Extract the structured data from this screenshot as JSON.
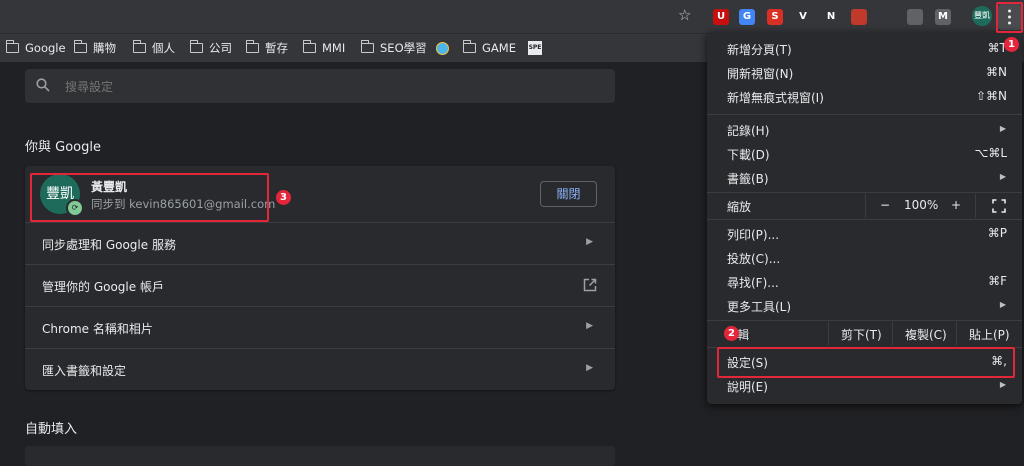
{
  "toolbar": {
    "profile_label": "豐凱",
    "extensions": [
      {
        "name": "ublock",
        "glyph": "U",
        "color": "#c70f0f"
      },
      {
        "name": "translate",
        "glyph": "G",
        "color": "#4285f4"
      },
      {
        "name": "s-ext",
        "glyph": "S",
        "color": "#d93025"
      },
      {
        "name": "vue",
        "glyph": "V",
        "color": "#35363a"
      },
      {
        "name": "notion",
        "glyph": "N",
        "color": "#35363a"
      },
      {
        "name": "book",
        "glyph": "",
        "color": "#c0392b"
      },
      {
        "name": "github",
        "glyph": "",
        "color": "#35363a"
      },
      {
        "name": "stack",
        "glyph": "",
        "color": "#5f6368"
      },
      {
        "name": "m-ext",
        "glyph": "M",
        "color": "#5f6368"
      }
    ]
  },
  "bookmarks": [
    "Google",
    "購物",
    "個人",
    "公司",
    "暫存",
    "MMI",
    "SEO學習",
    "GAME"
  ],
  "bookmark_special": "SPE",
  "search": {
    "placeholder": "搜尋設定"
  },
  "section_you": {
    "title": "你與 Google",
    "avatar_text": "豐凱",
    "user_name": "黃豐凱",
    "user_sync": "同步到 kevin865601@gmail.com",
    "close_button": "關閉",
    "rows": [
      "同步處理和 Google 服務",
      "管理你的 Google 帳戶",
      "Chrome 名稱和相片",
      "匯入書籤和設定"
    ]
  },
  "section_autofill": {
    "title": "自動填入"
  },
  "menu": {
    "new_tab": "新增分頁(T)",
    "new_tab_sc": "⌘T",
    "new_window": "開新視窗(N)",
    "new_window_sc": "⌘N",
    "incognito": "新增無痕式視窗(I)",
    "incognito_sc": "⇧⌘N",
    "history": "記錄(H)",
    "downloads": "下載(D)",
    "downloads_sc": "⌥⌘L",
    "bookmarks": "書籤(B)",
    "zoom": "縮放",
    "zoom_minus": "−",
    "zoom_value": "100%",
    "zoom_plus": "+",
    "print": "列印(P)...",
    "print_sc": "⌘P",
    "cast": "投放(C)...",
    "find": "尋找(F)...",
    "find_sc": "⌘F",
    "more_tools": "更多工具(L)",
    "edit": "輯",
    "cut": "剪下(T)",
    "copy": "複製(C)",
    "paste": "貼上(P)",
    "settings": "設定(S)",
    "settings_sc": "⌘,",
    "help": "說明(E)"
  },
  "badges": {
    "b1": "1",
    "b2": "2",
    "b3": "3"
  },
  "accent_color": "#e3263a"
}
